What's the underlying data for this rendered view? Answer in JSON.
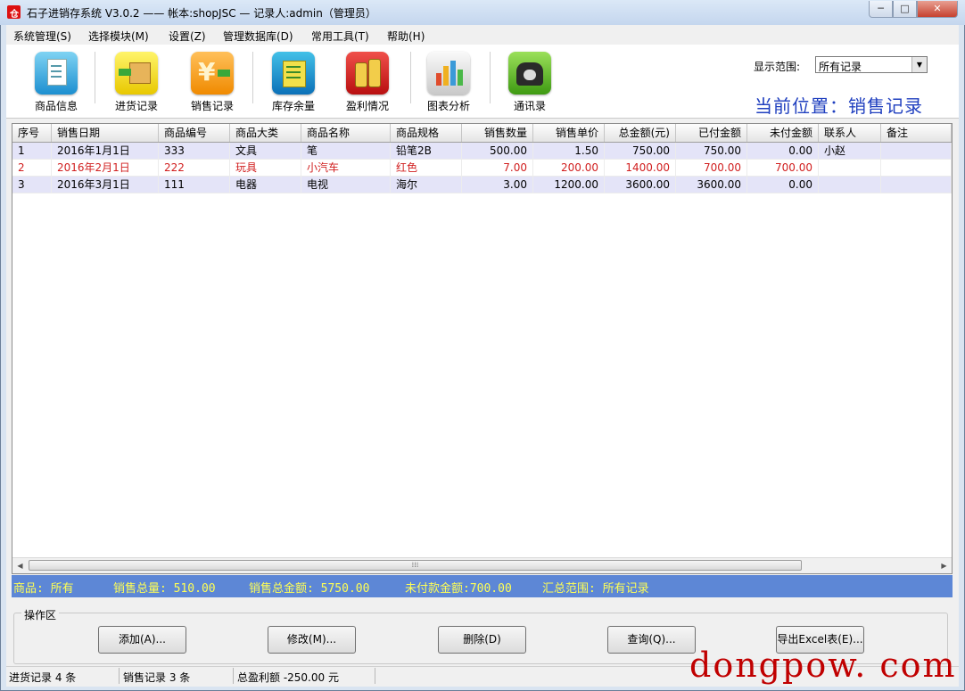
{
  "window": {
    "title": "石子进销存系统 V3.0.2  —— 帐本:shopJSC — 记录人:admin（管理员）",
    "min_label": "─",
    "max_label": "□",
    "close_label": "✕"
  },
  "menu": [
    "系统管理(S)",
    "选择模块(M)",
    "设置(Z)",
    "管理数据库(D)",
    "常用工具(T)",
    "帮助(H)"
  ],
  "toolbar": {
    "items": [
      {
        "label": "商品信息",
        "icon": "document-icon"
      },
      {
        "label": "进货记录",
        "icon": "box-import-icon"
      },
      {
        "label": "销售记录",
        "icon": "yen-export-icon"
      },
      {
        "label": "库存余量",
        "icon": "inventory-icon"
      },
      {
        "label": "盈利情况",
        "icon": "coins-icon"
      },
      {
        "label": "图表分析",
        "icon": "bar-chart-icon"
      },
      {
        "label": "通讯录",
        "icon": "telephone-icon"
      }
    ],
    "range_label": "显示范围:",
    "range_value": "所有记录",
    "location": "当前位置：销售记录"
  },
  "table": {
    "columns": [
      "序号",
      "销售日期",
      "商品编号",
      "商品大类",
      "商品名称",
      "商品规格",
      "销售数量",
      "销售单价",
      "总金额(元)",
      "已付金额",
      "未付金额",
      "联系人",
      "备注"
    ],
    "rows": [
      [
        "1",
        "2016年1月1日",
        "333",
        "文具",
        "笔",
        "铅笔2B",
        "500.00",
        "1.50",
        "750.00",
        "750.00",
        "0.00",
        "小赵",
        ""
      ],
      [
        "2",
        "2016年2月1日",
        "222",
        "玩具",
        "小汽车",
        "红色",
        "7.00",
        "200.00",
        "1400.00",
        "700.00",
        "700.00",
        "",
        ""
      ],
      [
        "3",
        "2016年3月1日",
        "111",
        "电器",
        "电视",
        "海尔",
        "3.00",
        "1200.00",
        "3600.00",
        "3600.00",
        "0.00",
        "",
        ""
      ]
    ],
    "highlight_row_color": "#d11f1f",
    "row_alt_color": "#e4e4f8",
    "scroll_grip": "⁞⁞⁞"
  },
  "summary": {
    "goods": "商品: 所有",
    "total_qty": "销售总量: 510.00",
    "total_amount": "销售总金额: 5750.00",
    "unpaid": "未付款金额:700.00",
    "scope": "汇总范围: 所有记录"
  },
  "ops": {
    "title": "操作区",
    "add": "添加(A)...",
    "edit": "修改(M)...",
    "delete": "删除(D)",
    "query": "查询(Q)...",
    "export": "导出Excel表(E)..."
  },
  "status": {
    "purchase": "进货记录 4 条",
    "sales": "销售记录 3 条",
    "profit": "总盈利额 -250.00 元"
  },
  "watermark": "dongpow. com"
}
